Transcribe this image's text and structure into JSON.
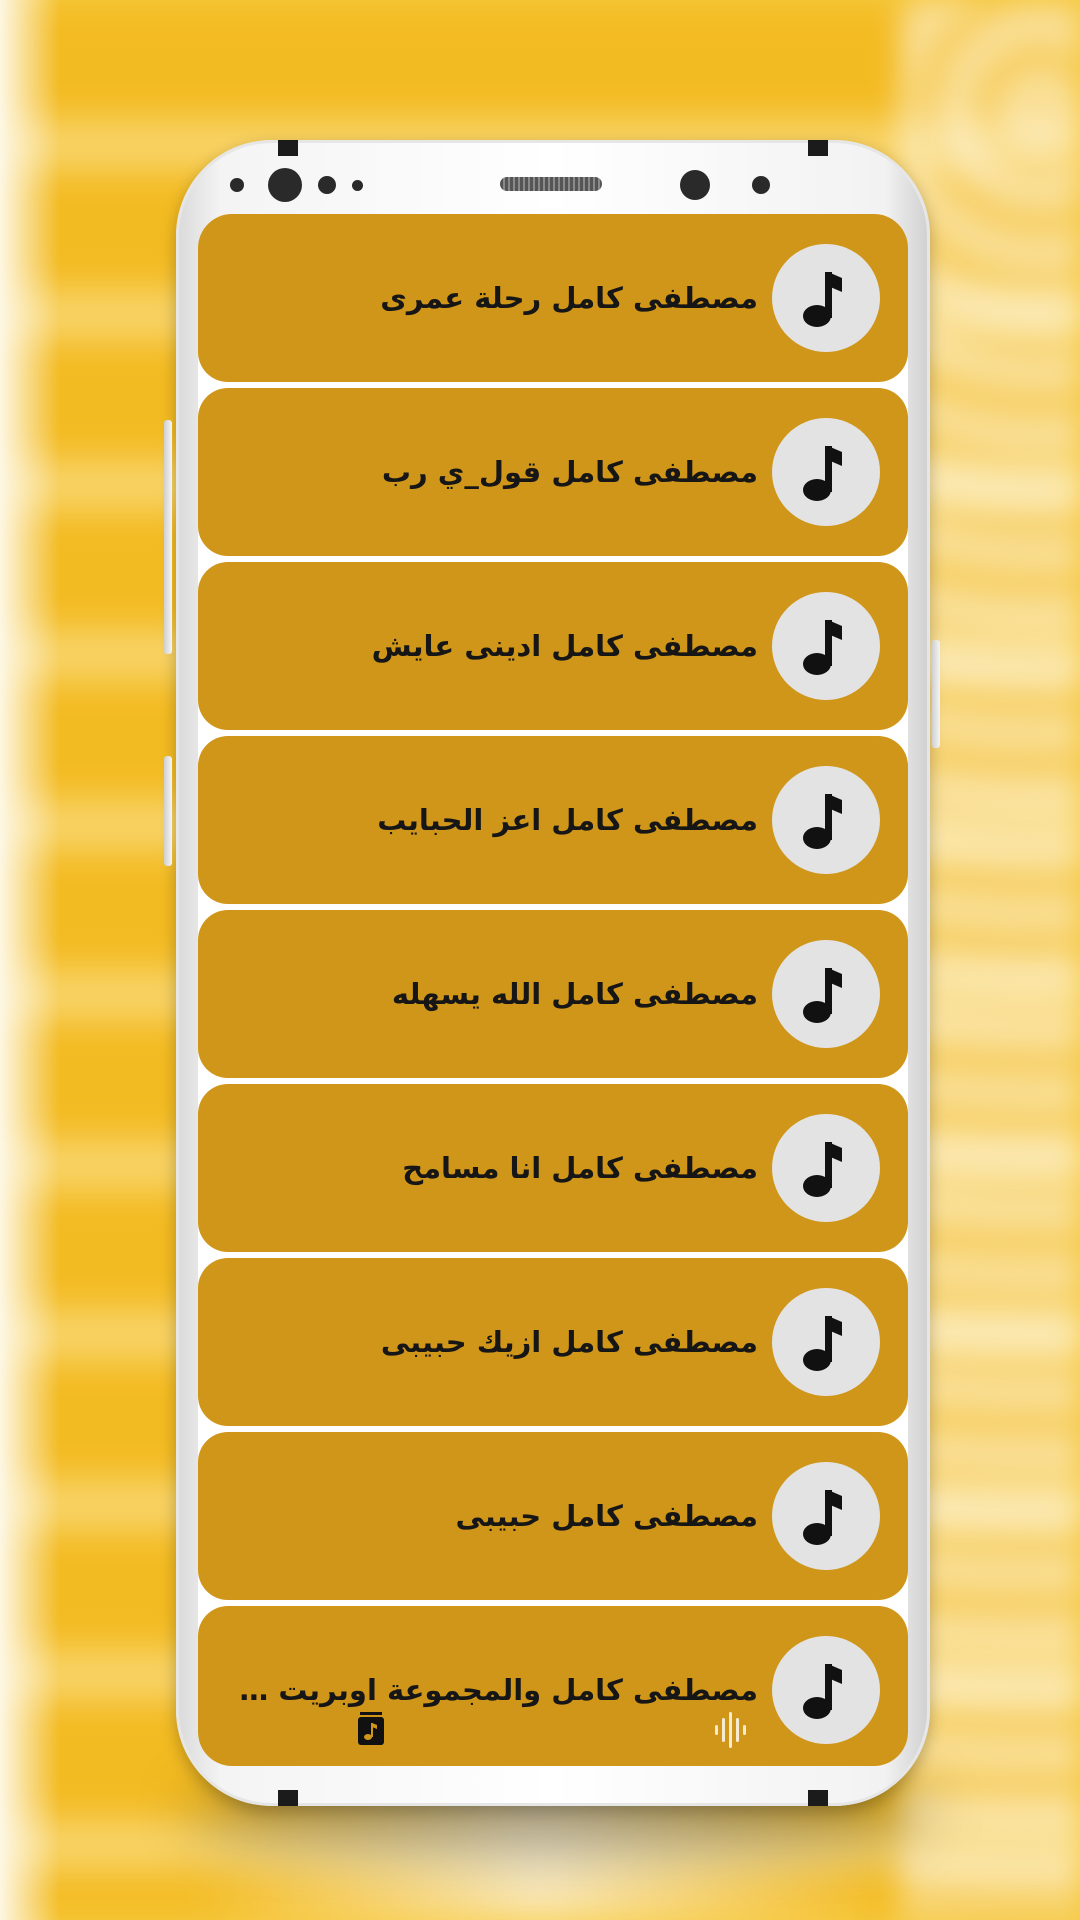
{
  "theme": {
    "item_color": "#d09619",
    "background_color": "#f6cc45",
    "icon_circle_color": "#e3e3e3"
  },
  "songs": [
    {
      "title": "مصطفى كامل رحلة عمرى",
      "icon": "music-note-icon"
    },
    {
      "title": "مصطفى كامل قول_ي رب",
      "icon": "music-note-icon"
    },
    {
      "title": "مصطفى كامل ادينى عايش",
      "icon": "music-note-icon"
    },
    {
      "title": "مصطفى كامل اعز الحبايب",
      "icon": "music-note-icon"
    },
    {
      "title": "مصطفى كامل الله يسهله",
      "icon": "music-note-icon"
    },
    {
      "title": "مصطفى كامل انا مسامح",
      "icon": "music-note-icon"
    },
    {
      "title": "مصطفى كامل ازيك حبيبى",
      "icon": "music-note-icon"
    },
    {
      "title": "مصطفى كامل حبيبى",
      "icon": "music-note-icon"
    },
    {
      "title": "مصطفى كامل والمجموعة اوبريت ت...",
      "icon": "music-note-icon"
    }
  ],
  "bottom_nav": {
    "left_icon": "music-library-icon",
    "right_icon": "audio-wave-icon"
  }
}
